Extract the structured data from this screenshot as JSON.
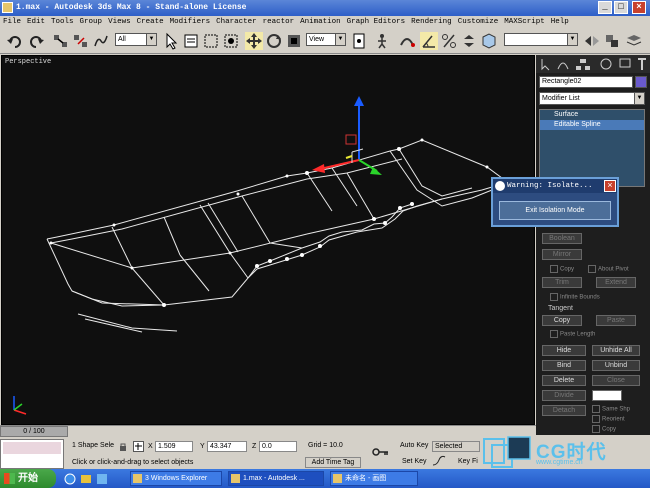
{
  "window": {
    "title": "1.max - Autodesk 3ds Max 8  - Stand-alone License",
    "controls": [
      "_",
      "□",
      "×"
    ]
  },
  "menu": [
    "File",
    "Edit",
    "Tools",
    "Group",
    "Views",
    "Create",
    "Modifiers",
    "Character",
    "reactor",
    "Animation",
    "Graph Editors",
    "Rendering",
    "Customize",
    "MAXScript",
    "Help"
  ],
  "toolbar": {
    "selection_filter": "All",
    "ref_coord": "View"
  },
  "viewport": {
    "label": "Perspective"
  },
  "command_panel": {
    "object_name": "Rectangle02",
    "object_color": "#6a5acd",
    "modifier_list": "Modifier List",
    "stack": [
      "Surface",
      "Editable Spline"
    ],
    "buttons": {
      "boolean": "Boolean",
      "mirror": "Mirror",
      "copy_check": "Copy",
      "about_pivot": "About Pivot",
      "trim": "Trim",
      "extend": "Extend",
      "infinite_bounds": "Infinite Bounds",
      "tangent": "Tangent",
      "tan_copy": "Copy",
      "tan_paste": "Paste",
      "paste_length": "Paste Length",
      "hide": "Hide",
      "unhide_all": "Unhide All",
      "bind": "Bind",
      "unbind": "Unbind",
      "delete": "Delete",
      "close": "Close",
      "divide": "Divide",
      "detach": "Detach",
      "same_shp": "Same Shp",
      "reorient": "Reorient",
      "copy2": "Copy"
    }
  },
  "dialog": {
    "title": "Warning: Isolate...",
    "button": "Exit Isolation Mode"
  },
  "status": {
    "time_slider": "0 / 100",
    "selection": "1 Shape Sele",
    "prompt": "Click or click-and-drag to select objects",
    "x_label": "X",
    "x": "1.509",
    "y_label": "Y",
    "y": "43.347",
    "z_label": "Z",
    "z": "0.0",
    "grid": "Grid = 10.0",
    "add_time_tag": "Add Time Tag",
    "auto_key": "Auto Key",
    "selected": "Selected",
    "set_key": "Set Key",
    "key_filters": "Key Fi"
  },
  "taskbar": {
    "start": "开始",
    "tasks": [
      "3 Windows Explorer",
      "1.max - Autodesk ...",
      "未命名 - 画图"
    ]
  },
  "watermark": {
    "brand": "CG时代",
    "url": "www.cgtime.cn"
  },
  "colors": {
    "accent": "#2d5ec8",
    "viewport_bg": "#0f0f0f",
    "dialog": "#2d4c80"
  }
}
